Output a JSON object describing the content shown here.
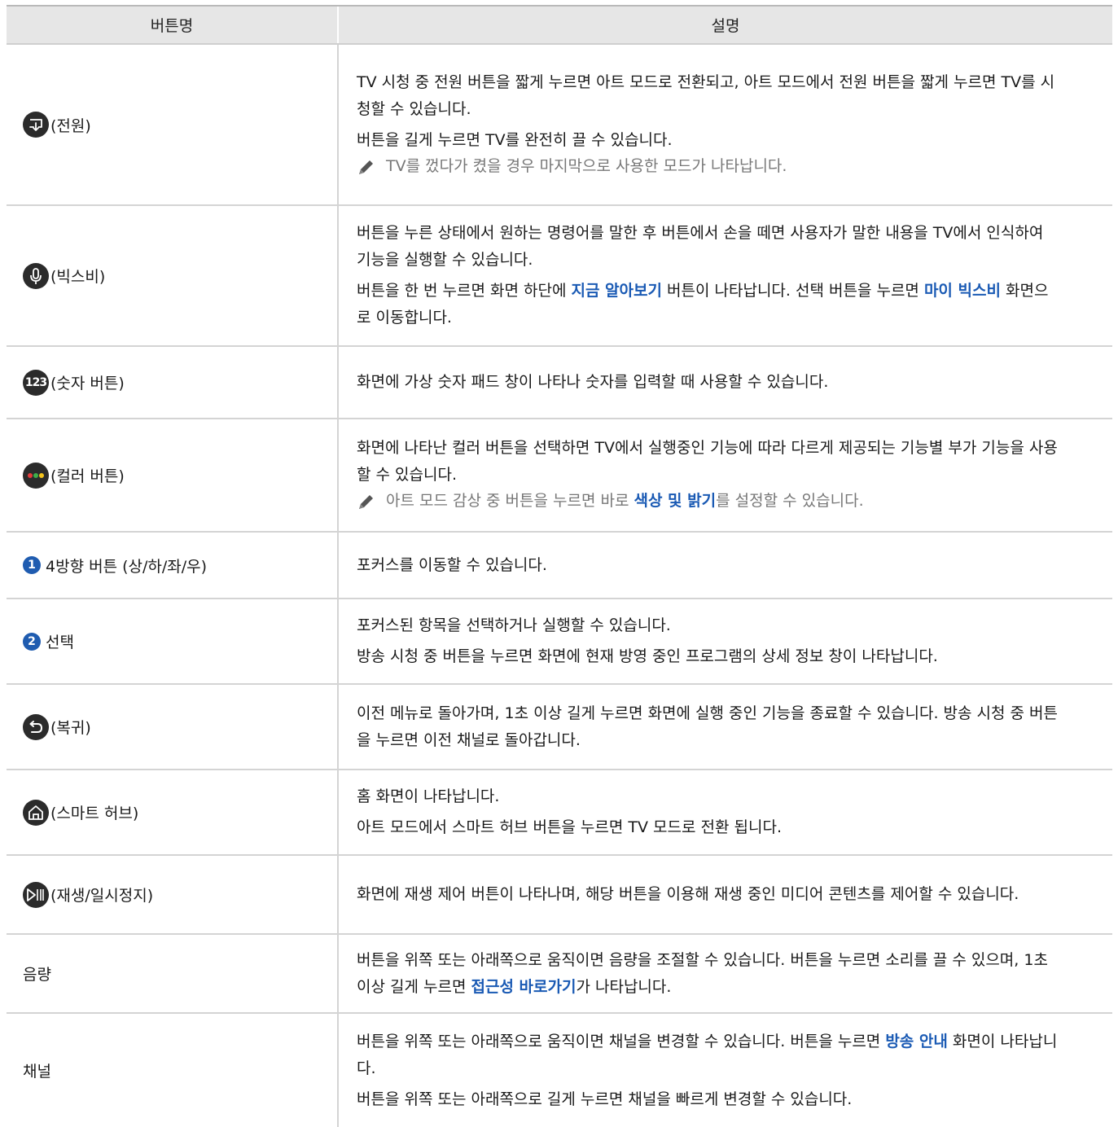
{
  "headers": {
    "name": "버튼명",
    "desc": "설명"
  },
  "rows": {
    "power": {
      "name": "(전원)",
      "p1": "TV 시청 중 전원 버튼을 짧게 누르면 아트 모드로 전환되고, 아트 모드에서 전원 버튼을 짧게 누르면 TV를 시청할 수 있습니다.",
      "p2": "버튼을 길게 누르면 TV를 완전히 끌 수 있습니다.",
      "note": "TV를 껐다가 켰을 경우 마지막으로 사용한 모드가 나타납니다."
    },
    "bixby": {
      "name": "(빅스비)",
      "p1": "버튼을 누른 상태에서 원하는 명령어를 말한 후 버튼에서 손을 떼면 사용자가 말한 내용을 TV에서 인식하여 기능을 실행할 수 있습니다.",
      "p2_a": "버튼을 한 번 누르면 화면 하단에 ",
      "p2_link1": "지금 알아보기",
      "p2_b": " 버튼이 나타납니다. 선택 버튼을 누르면 ",
      "p2_link2": "마이 빅스비",
      "p2_c": " 화면으로 이동합니다."
    },
    "number": {
      "icon_text": "123",
      "name": "(숫자 버튼)",
      "p1": "화면에 가상 숫자 패드 창이 나타나 숫자를 입력할 때 사용할 수 있습니다."
    },
    "color": {
      "name": "(컬러 버튼)",
      "p1": "화면에 나타난 컬러 버튼을 선택하면 TV에서 실행중인 기능에 따라 다르게 제공되는 기능별 부가 기능을 사용할 수 있습니다.",
      "note_a": "아트 모드 감상 중 버튼을 누르면 바로 ",
      "note_link": "색상 및 밝기",
      "note_b": "를 설정할 수 있습니다.",
      "dot_colors": [
        "#e23b3b",
        "#3fae49",
        "#f2c21b"
      ]
    },
    "direction": {
      "badge": "1",
      "name": "4방향 버튼 (상/하/좌/우)",
      "p1": "포커스를 이동할 수 있습니다."
    },
    "select": {
      "badge": "2",
      "name": "선택",
      "p1": "포커스된 항목을 선택하거나 실행할 수 있습니다.",
      "p2": "방송 시청 중 버튼을 누르면 화면에 현재 방영 중인 프로그램의 상세 정보 창이 나타납니다."
    },
    "back": {
      "name": "(복귀)",
      "p1": "이전 메뉴로 돌아가며, 1초 이상 길게 누르면 화면에 실행 중인 기능을 종료할 수 있습니다. 방송 시청 중 버튼을 누르면 이전 채널로 돌아갑니다."
    },
    "home": {
      "name": "(스마트 허브)",
      "p1": "홈 화면이 나타납니다.",
      "p2": "아트 모드에서 스마트 허브 버튼을 누르면 TV 모드로 전환 됩니다."
    },
    "play": {
      "name": "(재생/일시정지)",
      "p1": "화면에 재생 제어 버튼이 나타나며, 해당 버튼을 이용해 재생 중인 미디어 콘텐츠를 제어할 수 있습니다."
    },
    "volume": {
      "name": "음량",
      "p1_a": "버튼을 위쪽 또는 아래쪽으로 움직이면 음량을 조절할 수 있습니다. 버튼을 누르면 소리를 끌 수 있으며, 1초 이상 길게 누르면 ",
      "p1_link": "접근성 바로가기",
      "p1_b": "가 나타납니다."
    },
    "channel": {
      "name": "채널",
      "p1_a": "버튼을 위쪽 또는 아래쪽으로 움직이면 채널을 변경할 수 있습니다. 버튼을 누르면 ",
      "p1_link": "방송 안내",
      "p1_b": " 화면이 나타납니다.",
      "p2": "버튼을 위쪽 또는 아래쪽으로 길게 누르면 채널을 빠르게 변경할 수 있습니다."
    }
  },
  "colors": {
    "link": "#1a5ab4",
    "note": "#777777",
    "header_bg": "#e6e6e6",
    "badge": "#1f5cb0",
    "icon_bg": "#2b2b2b"
  }
}
